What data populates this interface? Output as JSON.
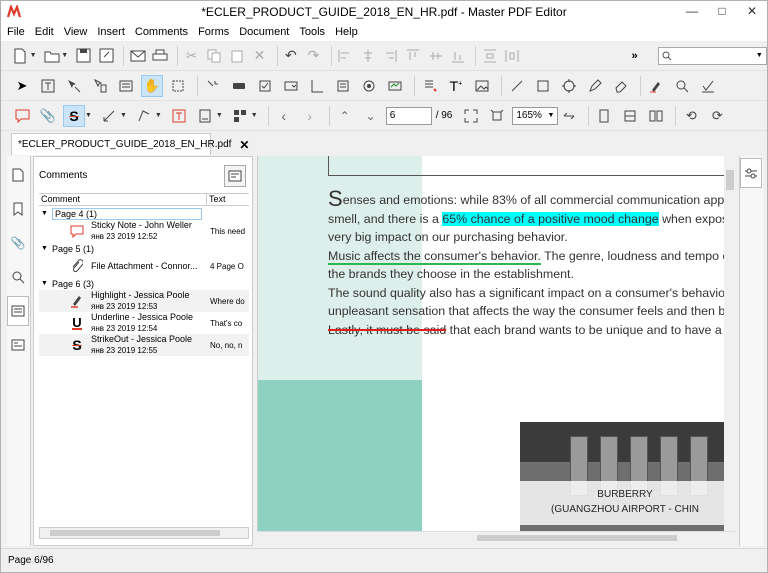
{
  "window": {
    "title": "*ECLER_PRODUCT_GUIDE_2018_EN_HR.pdf - Master PDF Editor",
    "accent": "#e03a2a"
  },
  "menu": [
    "File",
    "Edit",
    "View",
    "Insert",
    "Comments",
    "Forms",
    "Document",
    "Tools",
    "Help"
  ],
  "toolbar1": {
    "icons": [
      "new-document-icon",
      "open-folder-icon",
      "save-icon",
      "save-as-icon",
      "email-icon",
      "print-icon",
      "cut-icon",
      "copy-icon",
      "paste-icon",
      "delete-icon",
      "undo-icon",
      "redo-icon",
      "align-left-icon",
      "align-center-icon",
      "align-right-icon",
      "align-top-icon",
      "align-middle-icon",
      "align-bottom-icon",
      "distribute-icon",
      "distribute-vertical-icon",
      "more-icon"
    ],
    "search_placeholder": ""
  },
  "toolbar2": {
    "icons": [
      "select-arrow-icon",
      "edit-text-icon",
      "edit-objects-icon",
      "edit-forms-icon",
      "text-box-icon",
      "hand-tool-icon",
      "marquee-zoom-icon",
      "insert-image-icon",
      "button-field-icon",
      "checkbox-field-icon",
      "combo-field-icon",
      "list-field-icon",
      "radio-field-icon",
      "signature-field-icon",
      "text-edit-icon",
      "add-text-icon",
      "image-icon",
      "line-icon",
      "rectangle-icon",
      "shape-icon",
      "pencil-icon",
      "eraser-icon",
      "highlight-pen-icon",
      "search-icon",
      "checkmark-icon"
    ]
  },
  "toolbar3": {
    "page_value": "6",
    "page_total": "/ 96",
    "zoom_value": "165%"
  },
  "tab": {
    "label": "*ECLER_PRODUCT_GUIDE_2018_EN_HR.pdf"
  },
  "comments_panel": {
    "title": "Comments",
    "col_comment": "Comment",
    "col_text": "Text",
    "groups": [
      {
        "label": "Page 4 (1)",
        "items": [
          {
            "icon": "sticky-note-icon",
            "title": "Sticky Note - John Weller",
            "date": "янв 23 2019 12:52",
            "text": "This need"
          }
        ]
      },
      {
        "label": "Page 5 (1)",
        "items": [
          {
            "icon": "paperclip-icon",
            "title": "File Attachment - Connor...",
            "date": "",
            "text": "4 Page O"
          }
        ]
      },
      {
        "label": "Page 6 (3)",
        "items": [
          {
            "icon": "highlight-icon",
            "title": "Highlight - Jessica Poole",
            "date": "янв 23 2019 12:53",
            "text": "Where do"
          },
          {
            "icon": "underline-icon",
            "title": "Underline - Jessica Poole",
            "date": "янв 23 2019 12:54",
            "text": "That's co"
          },
          {
            "icon": "strikeout-icon",
            "title": "StrikeOut - Jessica Poole",
            "date": "янв 23 2019 12:55",
            "text": "No, no, n"
          }
        ]
      }
    ]
  },
  "document": {
    "drop_cap": "S",
    "line1_rest": "enses and emotions: while 83% of all commercial communication appeals o",
    "line2_pre": "smell, and there is a ",
    "line2_highlight": "65% chance of a positive mood change",
    "line2_post": " when exposed to \"",
    "line3": "very big impact on our purchasing behavior.",
    "line4_underline": "Music affects the consumer's behavior.",
    "line4_post": " The genre, loudness and tempo of mus",
    "line5": "the brands they choose in the establishment.",
    "line6": "The sound quality also has a significant impact on a consumer's behavior. Disto",
    "line7": "unpleasant sensation that affects the way the consumer feels and then behave",
    "line8_strike": "Lastly, it must be said",
    "line8_post": " that each brand wants to be unique and to have a clear p",
    "photo_caption1": "BURBERRY",
    "photo_caption2": "(GUANGZHOU AIRPORT - CHIN",
    "highlight_color": "#00ffff",
    "underline_color": "#2db84a",
    "strike_color": "#e02020"
  },
  "status": {
    "page": "Page 6/96"
  }
}
